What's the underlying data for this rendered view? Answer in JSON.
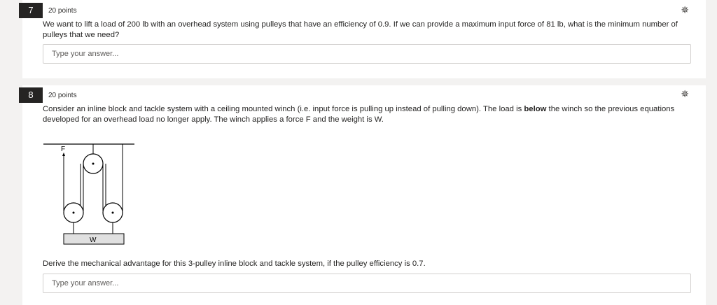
{
  "questions": [
    {
      "number": "7",
      "points": "20 points",
      "text": "We want to lift a load of 200 lb with an overhead system using pulleys that have an efficiency of 0.9. If we can provide a maximum input force of 81 lb, what is the minimum number of pulleys that we need?",
      "answer_placeholder": "Type your answer...",
      "pin_icon": "pin-icon"
    },
    {
      "number": "8",
      "points": "20 points",
      "text_part1": "Consider an inline block and tackle system with a ceiling mounted winch (i.e. input force is pulling up instead of pulling down). The load is ",
      "text_bold": "below",
      "text_part2": " the winch so the previous equations developed for an overhead load no longer apply. The winch applies a force F and the weight is W.",
      "figure": {
        "force_label": "F",
        "weight_label": "W"
      },
      "prompt": "Derive the mechanical advantage for this 3-pulley inline block and tackle system, if the pulley efficiency is 0.7.",
      "answer_placeholder": "Type your answer...",
      "pin_icon": "pin-icon"
    }
  ]
}
